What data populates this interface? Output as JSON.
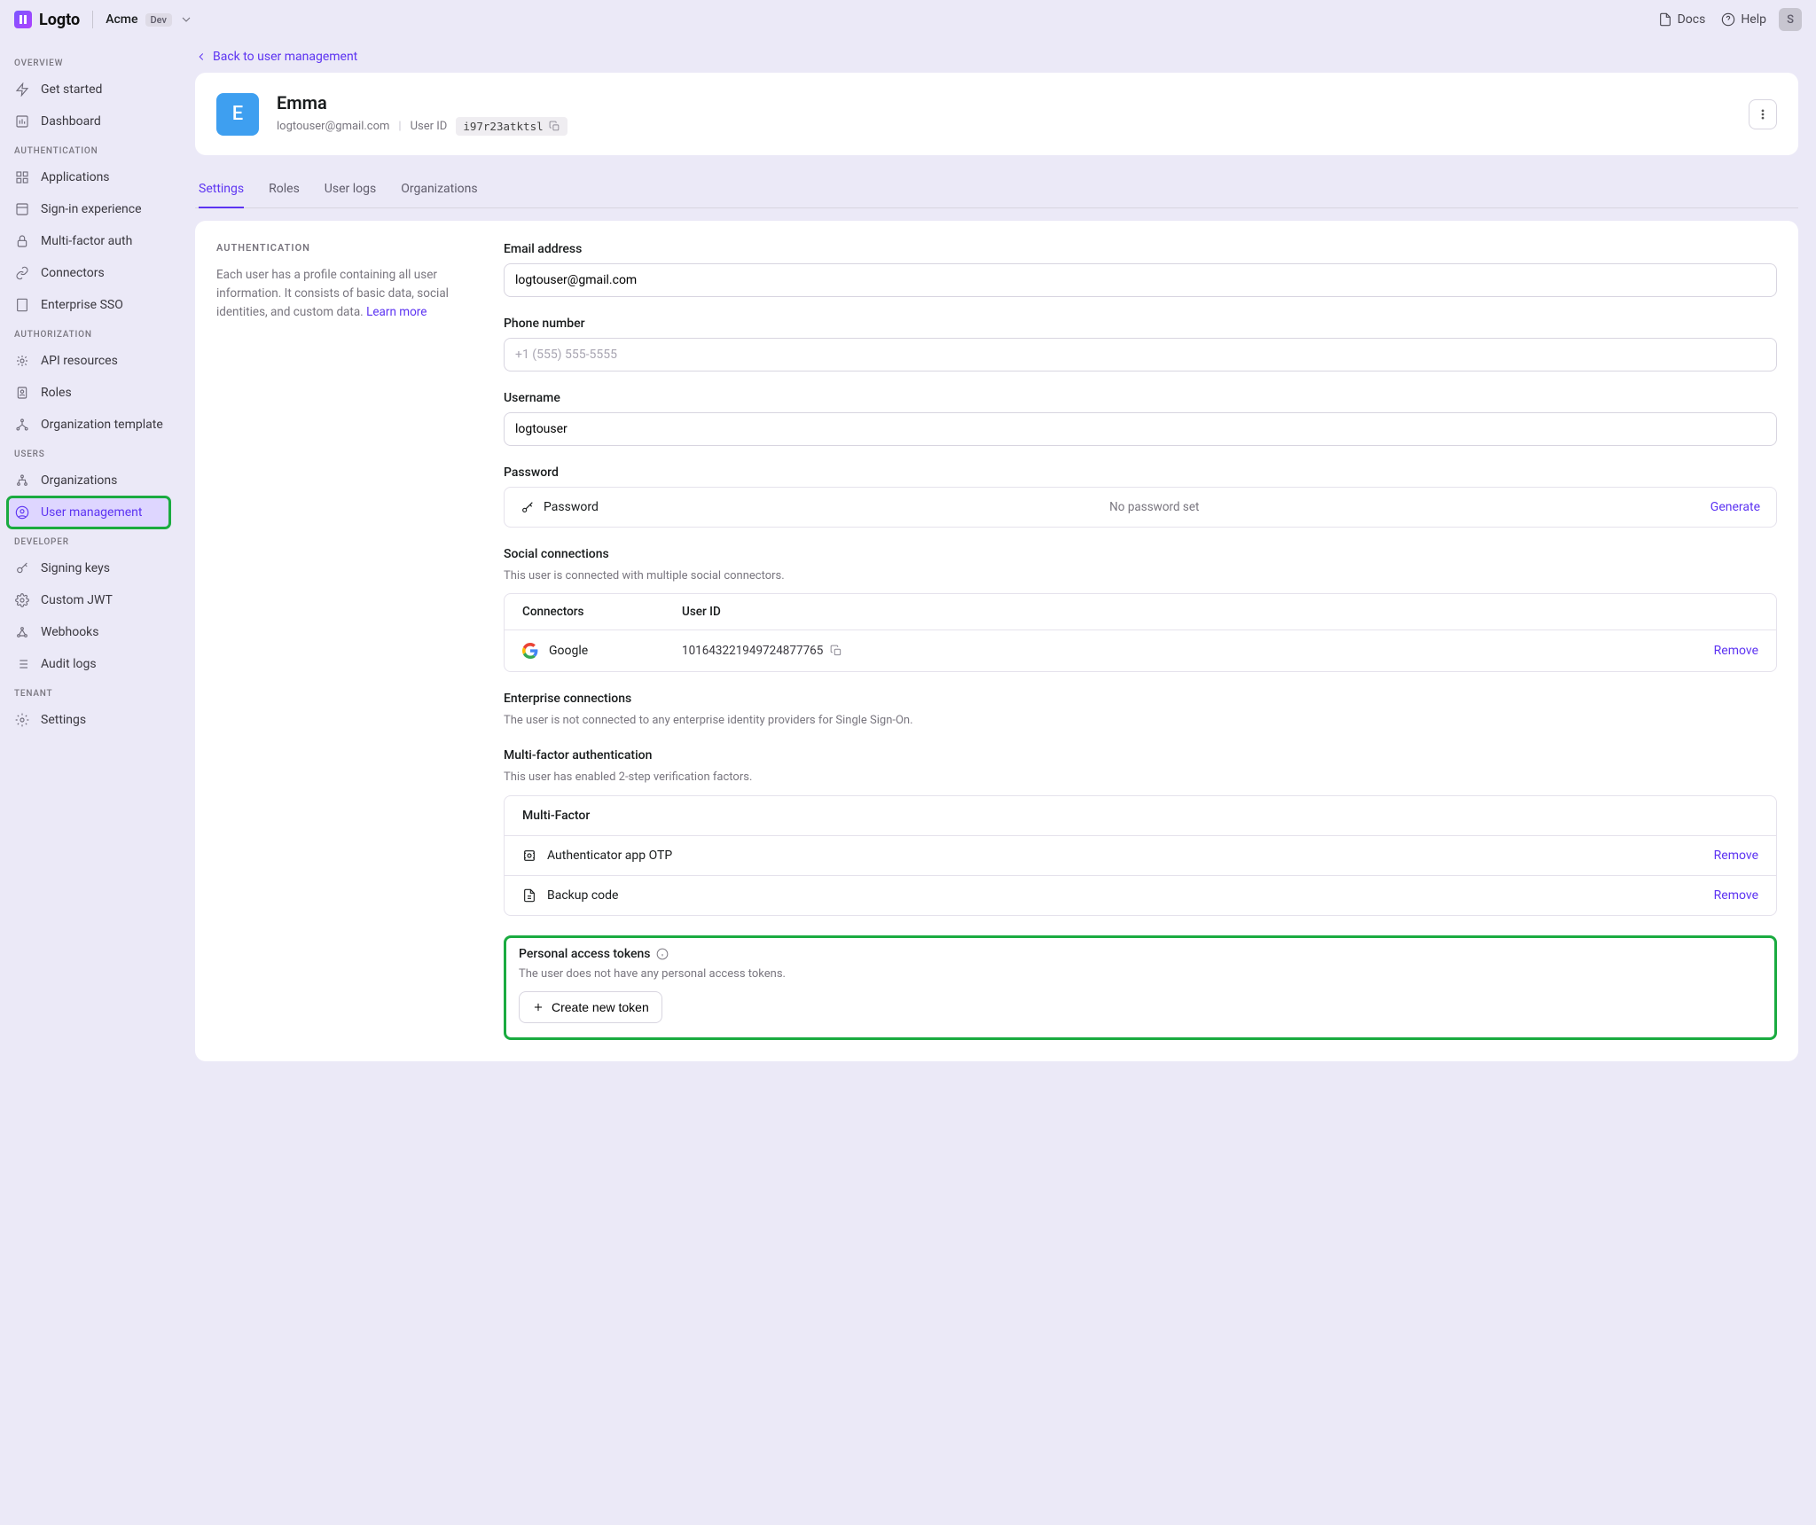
{
  "brand": "Logto",
  "tenant": {
    "name": "Acme",
    "badge": "Dev"
  },
  "topbar": {
    "docs": "Docs",
    "help": "Help",
    "avatar_initial": "S"
  },
  "sidebar": {
    "sections": {
      "overview": {
        "label": "OVERVIEW",
        "items": [
          "Get started",
          "Dashboard"
        ]
      },
      "authn": {
        "label": "AUTHENTICATION",
        "items": [
          "Applications",
          "Sign-in experience",
          "Multi-factor auth",
          "Connectors",
          "Enterprise SSO"
        ]
      },
      "authz": {
        "label": "AUTHORIZATION",
        "items": [
          "API resources",
          "Roles",
          "Organization template"
        ]
      },
      "users": {
        "label": "USERS",
        "items": [
          "Organizations",
          "User management"
        ]
      },
      "dev": {
        "label": "DEVELOPER",
        "items": [
          "Signing keys",
          "Custom JWT",
          "Webhooks",
          "Audit logs"
        ]
      },
      "tenant": {
        "label": "TENANT",
        "items": [
          "Settings"
        ]
      }
    }
  },
  "back_link": "Back to user management",
  "user": {
    "initial": "E",
    "name": "Emma",
    "email": "logtouser@gmail.com",
    "user_id_label": "User ID",
    "user_id": "i97r23atktsl"
  },
  "tabs": [
    "Settings",
    "Roles",
    "User logs",
    "Organizations"
  ],
  "panel": {
    "title": "AUTHENTICATION",
    "desc": "Each user has a profile containing all user information. It consists of basic data, social identities, and custom data.",
    "learn": "Learn more"
  },
  "form": {
    "email_label": "Email address",
    "email_value": "logtouser@gmail.com",
    "phone_label": "Phone number",
    "phone_placeholder": "+1 (555) 555-5555",
    "username_label": "Username",
    "username_value": "logtouser",
    "password_label": "Password",
    "password_field": "Password",
    "password_status": "No password set",
    "password_action": "Generate",
    "social_label": "Social connections",
    "social_desc": "This user is connected with multiple social connectors.",
    "social_headers": {
      "connectors": "Connectors",
      "user_id": "User ID"
    },
    "social_row": {
      "name": "Google",
      "uid": "101643221949724877765",
      "action": "Remove"
    },
    "enterprise_label": "Enterprise connections",
    "enterprise_desc": "The user is not connected to any enterprise identity providers for Single Sign-On.",
    "mfa_label": "Multi-factor authentication",
    "mfa_desc": "This user has enabled 2-step verification factors.",
    "mfa_header": "Multi-Factor",
    "mfa_items": [
      {
        "label": "Authenticator app OTP",
        "action": "Remove"
      },
      {
        "label": "Backup code",
        "action": "Remove"
      }
    ],
    "pat_label": "Personal access tokens",
    "pat_desc": "The user does not have any personal access tokens.",
    "pat_button": "Create new token"
  }
}
